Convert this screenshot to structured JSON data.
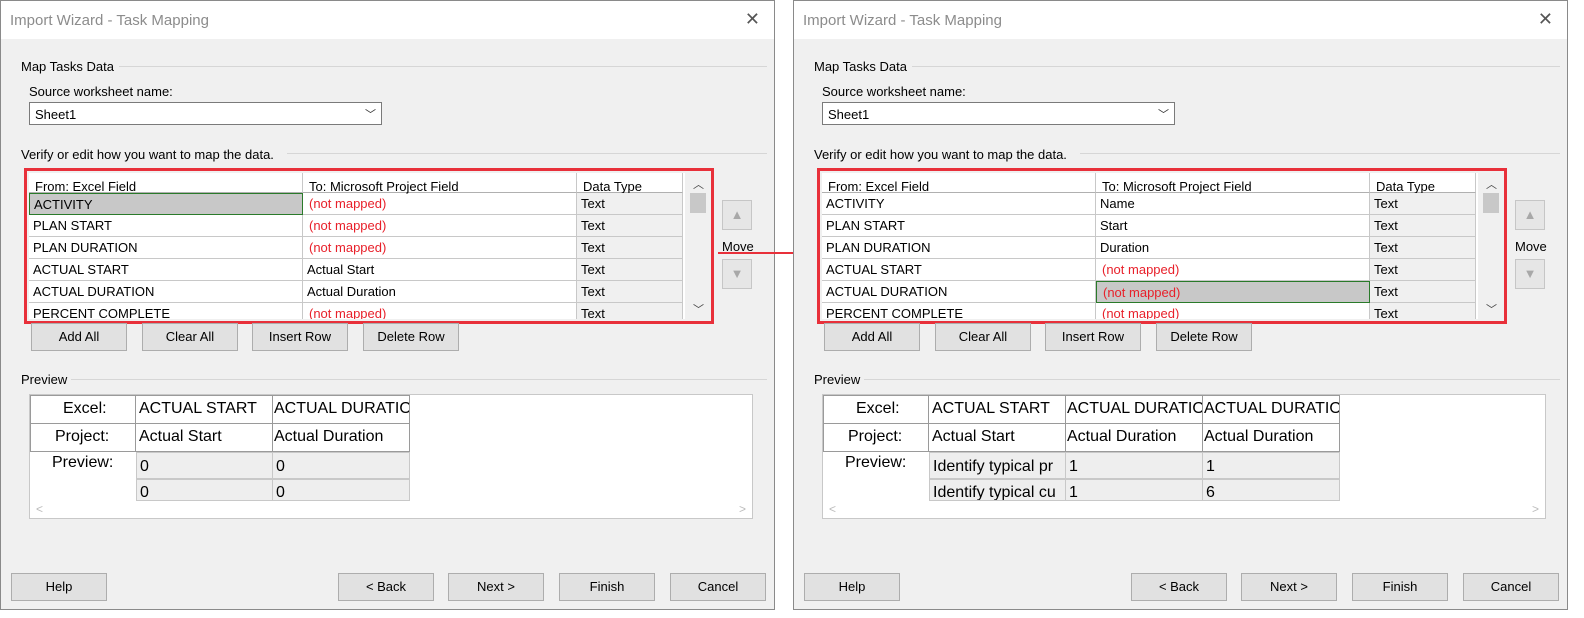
{
  "left": {
    "title": "Import Wizard - Task Mapping",
    "section_title": "Map Tasks Data",
    "source_label": "Source worksheet name:",
    "sheet_value": "Sheet1",
    "verify_label": "Verify or edit how you want to map the data.",
    "columns": [
      "From: Excel Field",
      "To:  Microsoft Project Field",
      "Data Type"
    ],
    "rows": [
      {
        "from": "ACTIVITY",
        "to": "(not mapped)",
        "type": "Text"
      },
      {
        "from": "PLAN START",
        "to": "(not mapped)",
        "type": "Text"
      },
      {
        "from": "PLAN DURATION",
        "to": "(not mapped)",
        "type": "Text"
      },
      {
        "from": "ACTUAL START",
        "to": "Actual Start",
        "type": "Text"
      },
      {
        "from": "ACTUAL DURATION",
        "to": "Actual Duration",
        "type": "Text"
      },
      {
        "from": "PERCENT COMPLETE",
        "to": "(not mapped)",
        "type": "Text"
      }
    ],
    "move_label": "Move",
    "buttons": {
      "add_all": "Add All",
      "clear_all": "Clear All",
      "insert_row": "Insert Row",
      "delete_row": "Delete Row"
    },
    "preview_label": "Preview",
    "preview": {
      "excel_label": "Excel:",
      "project_label": "Project:",
      "preview_label": "Preview:",
      "excel": [
        "ACTUAL START",
        "ACTUAL DURATIO"
      ],
      "project": [
        "Actual Start",
        "Actual Duration"
      ],
      "data": [
        [
          "0",
          "0"
        ],
        [
          "0",
          "0"
        ]
      ]
    },
    "footer": {
      "help": "Help",
      "back": "< Back",
      "next": "Next >",
      "finish": "Finish",
      "cancel": "Cancel"
    }
  },
  "right": {
    "title": "Import Wizard - Task Mapping",
    "section_title": "Map Tasks Data",
    "source_label": "Source worksheet name:",
    "sheet_value": "Sheet1",
    "verify_label": "Verify or edit how you want to map the data.",
    "columns": [
      "From: Excel Field",
      "To:  Microsoft Project Field",
      "Data Type"
    ],
    "rows": [
      {
        "from": "ACTIVITY",
        "to": "Name",
        "type": "Text"
      },
      {
        "from": "PLAN START",
        "to": "Start",
        "type": "Text"
      },
      {
        "from": "PLAN DURATION",
        "to": "Duration",
        "type": "Text"
      },
      {
        "from": "ACTUAL START",
        "to": "(not mapped)",
        "type": "Text"
      },
      {
        "from": "ACTUAL DURATION",
        "to": "(not mapped)",
        "type": "Text"
      },
      {
        "from": "PERCENT COMPLETE",
        "to": "(not mapped)",
        "type": "Text"
      }
    ],
    "move_label": "Move",
    "buttons": {
      "add_all": "Add All",
      "clear_all": "Clear All",
      "insert_row": "Insert Row",
      "delete_row": "Delete Row"
    },
    "preview_label": "Preview",
    "preview": {
      "excel_label": "Excel:",
      "project_label": "Project:",
      "preview_label": "Preview:",
      "excel": [
        "ACTUAL START",
        "ACTUAL DURATIO",
        "ACTUAL DURATIO"
      ],
      "project": [
        "Actual Start",
        "Actual Duration",
        "Actual Duration"
      ],
      "data": [
        [
          "Identify typical pr",
          "1",
          "1"
        ],
        [
          "Identify typical cu",
          "1",
          "6"
        ]
      ]
    },
    "footer": {
      "help": "Help",
      "back": "< Back",
      "next": "Next >",
      "finish": "Finish",
      "cancel": "Cancel"
    }
  },
  "colors": {
    "highlight": "#e8303a",
    "not_mapped_text": "#e8202a",
    "selected_cell": "#c8c8c8",
    "dialog_bg": "#f0f0f0"
  }
}
